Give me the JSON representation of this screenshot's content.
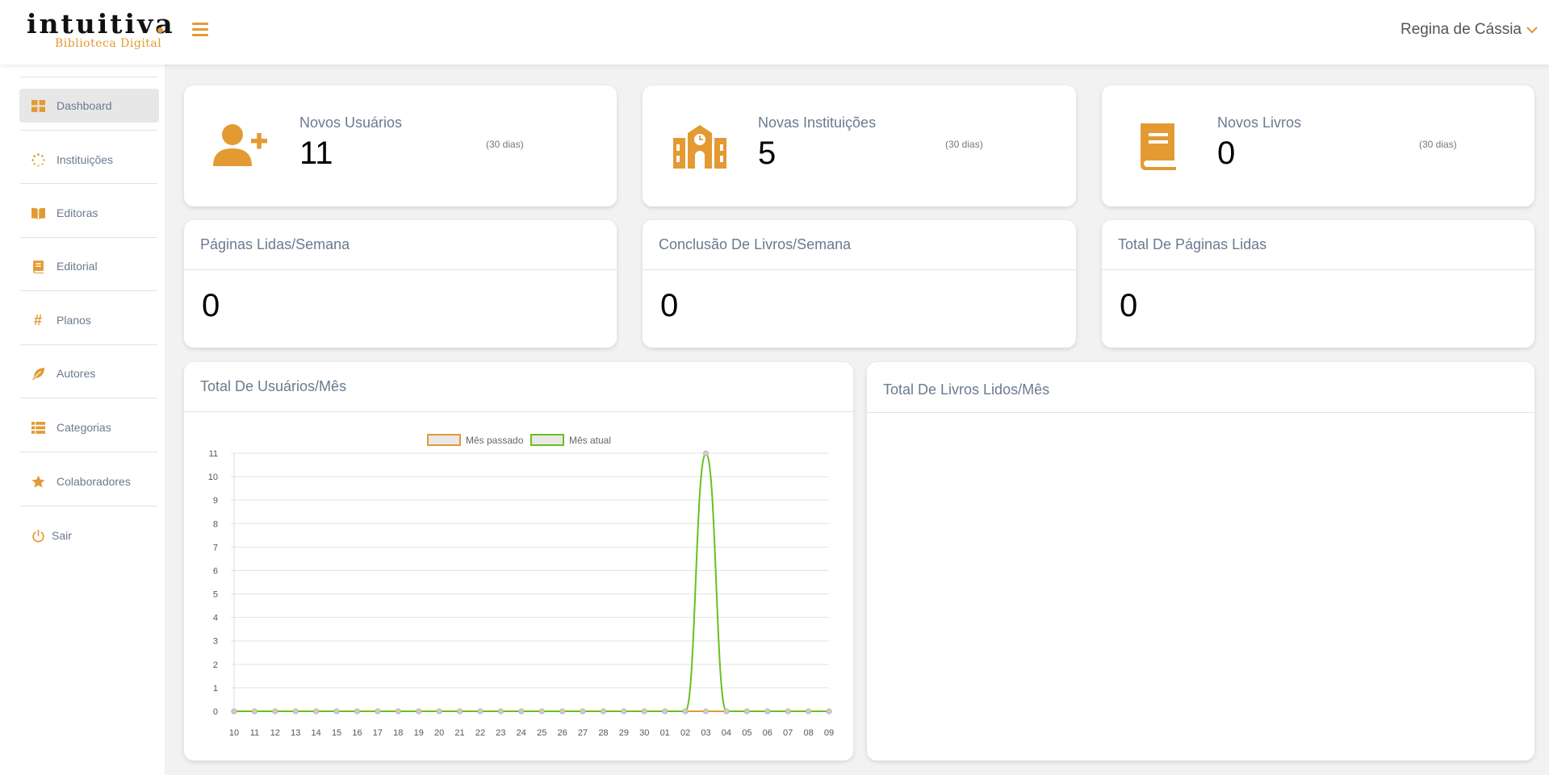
{
  "header": {
    "logo_word": "intuitiva",
    "logo_sub": "Biblioteca Digital",
    "user_name": "Regina de Cássia"
  },
  "sidebar": {
    "items": [
      {
        "label": "Dashboard",
        "icon": "grid-icon",
        "active": true
      },
      {
        "label": "Instituições",
        "icon": "spinner-icon",
        "active": false
      },
      {
        "label": "Editoras",
        "icon": "open-book-icon",
        "active": false
      },
      {
        "label": "Editorial",
        "icon": "book-icon",
        "active": false
      },
      {
        "label": "Planos",
        "icon": "hashtag-icon",
        "active": false
      },
      {
        "label": "Autores",
        "icon": "feather-icon",
        "active": false
      },
      {
        "label": "Categorias",
        "icon": "list-icon",
        "active": false
      },
      {
        "label": "Colaboradores",
        "icon": "star-icon",
        "active": false
      },
      {
        "label": "Sair",
        "icon": "power-icon",
        "active": false
      }
    ]
  },
  "stats": [
    {
      "label": "Novos Usuários",
      "value": "11",
      "period": "(30 dias)",
      "icon": "user-plus-icon"
    },
    {
      "label": "Novas Instituições",
      "value": "5",
      "period": "(30 dias)",
      "icon": "school-icon"
    },
    {
      "label": "Novos Livros",
      "value": "0",
      "period": "(30 dias)",
      "icon": "book-icon"
    }
  ],
  "panels": [
    {
      "title": "Páginas Lidas/Semana",
      "value": "0"
    },
    {
      "title": "Conclusão De Livros/Semana",
      "value": "0"
    },
    {
      "title": "Total De Páginas Lidas",
      "value": "0"
    }
  ],
  "users_chart": {
    "title": "Total De Usuários/Mês"
  },
  "books_chart": {
    "title": "Total De Livros Lidos/Mês"
  },
  "colors": {
    "accent": "#e39a33",
    "current_month": "#6bbf1f",
    "last_month": "#e39a33"
  },
  "chart_data": {
    "type": "line",
    "x": [
      "10",
      "11",
      "12",
      "13",
      "14",
      "15",
      "16",
      "17",
      "18",
      "19",
      "20",
      "21",
      "22",
      "23",
      "24",
      "25",
      "26",
      "27",
      "28",
      "29",
      "30",
      "01",
      "02",
      "03",
      "04",
      "05",
      "06",
      "07",
      "08",
      "09"
    ],
    "series": [
      {
        "name": "Mês passado",
        "values": [
          0,
          0,
          0,
          0,
          0,
          0,
          0,
          0,
          0,
          0,
          0,
          0,
          0,
          0,
          0,
          0,
          0,
          0,
          0,
          0,
          0,
          0,
          0,
          0,
          0,
          0,
          0,
          0,
          0,
          0
        ]
      },
      {
        "name": "Mês atual",
        "values": [
          0,
          0,
          0,
          0,
          0,
          0,
          0,
          0,
          0,
          0,
          0,
          0,
          0,
          0,
          0,
          0,
          0,
          0,
          0,
          0,
          0,
          0,
          0,
          11,
          0,
          0,
          0,
          0,
          0,
          0
        ]
      }
    ],
    "ylim": [
      0,
      11
    ],
    "yticks": [
      0,
      1,
      2,
      3,
      4,
      5,
      6,
      7,
      8,
      9,
      10,
      11
    ],
    "legend": "top",
    "grid": true
  }
}
